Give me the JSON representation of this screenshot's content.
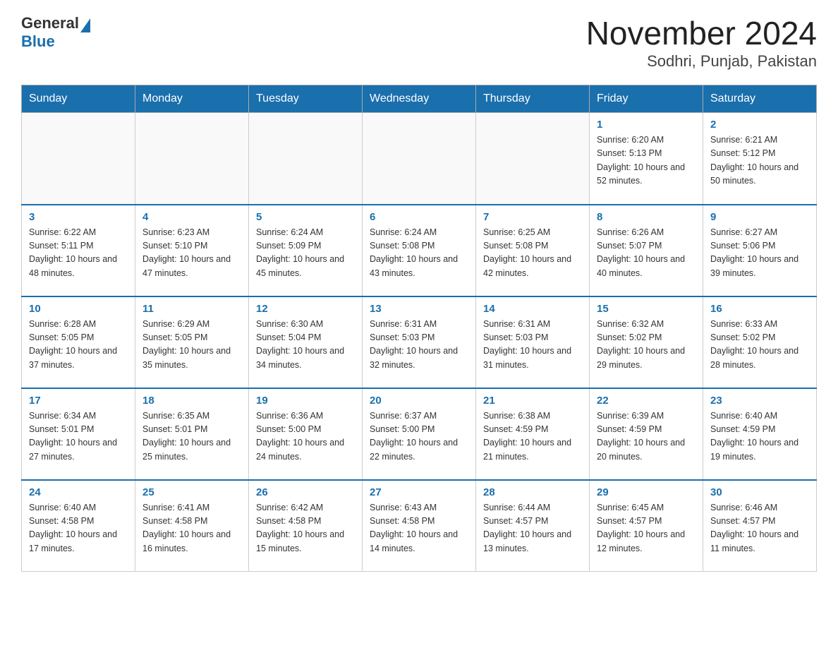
{
  "header": {
    "logo_general": "General",
    "logo_blue": "Blue",
    "title": "November 2024",
    "subtitle": "Sodhri, Punjab, Pakistan"
  },
  "days_of_week": [
    "Sunday",
    "Monday",
    "Tuesday",
    "Wednesday",
    "Thursday",
    "Friday",
    "Saturday"
  ],
  "weeks": [
    [
      {
        "day": "",
        "info": ""
      },
      {
        "day": "",
        "info": ""
      },
      {
        "day": "",
        "info": ""
      },
      {
        "day": "",
        "info": ""
      },
      {
        "day": "",
        "info": ""
      },
      {
        "day": "1",
        "info": "Sunrise: 6:20 AM\nSunset: 5:13 PM\nDaylight: 10 hours and 52 minutes."
      },
      {
        "day": "2",
        "info": "Sunrise: 6:21 AM\nSunset: 5:12 PM\nDaylight: 10 hours and 50 minutes."
      }
    ],
    [
      {
        "day": "3",
        "info": "Sunrise: 6:22 AM\nSunset: 5:11 PM\nDaylight: 10 hours and 48 minutes."
      },
      {
        "day": "4",
        "info": "Sunrise: 6:23 AM\nSunset: 5:10 PM\nDaylight: 10 hours and 47 minutes."
      },
      {
        "day": "5",
        "info": "Sunrise: 6:24 AM\nSunset: 5:09 PM\nDaylight: 10 hours and 45 minutes."
      },
      {
        "day": "6",
        "info": "Sunrise: 6:24 AM\nSunset: 5:08 PM\nDaylight: 10 hours and 43 minutes."
      },
      {
        "day": "7",
        "info": "Sunrise: 6:25 AM\nSunset: 5:08 PM\nDaylight: 10 hours and 42 minutes."
      },
      {
        "day": "8",
        "info": "Sunrise: 6:26 AM\nSunset: 5:07 PM\nDaylight: 10 hours and 40 minutes."
      },
      {
        "day": "9",
        "info": "Sunrise: 6:27 AM\nSunset: 5:06 PM\nDaylight: 10 hours and 39 minutes."
      }
    ],
    [
      {
        "day": "10",
        "info": "Sunrise: 6:28 AM\nSunset: 5:05 PM\nDaylight: 10 hours and 37 minutes."
      },
      {
        "day": "11",
        "info": "Sunrise: 6:29 AM\nSunset: 5:05 PM\nDaylight: 10 hours and 35 minutes."
      },
      {
        "day": "12",
        "info": "Sunrise: 6:30 AM\nSunset: 5:04 PM\nDaylight: 10 hours and 34 minutes."
      },
      {
        "day": "13",
        "info": "Sunrise: 6:31 AM\nSunset: 5:03 PM\nDaylight: 10 hours and 32 minutes."
      },
      {
        "day": "14",
        "info": "Sunrise: 6:31 AM\nSunset: 5:03 PM\nDaylight: 10 hours and 31 minutes."
      },
      {
        "day": "15",
        "info": "Sunrise: 6:32 AM\nSunset: 5:02 PM\nDaylight: 10 hours and 29 minutes."
      },
      {
        "day": "16",
        "info": "Sunrise: 6:33 AM\nSunset: 5:02 PM\nDaylight: 10 hours and 28 minutes."
      }
    ],
    [
      {
        "day": "17",
        "info": "Sunrise: 6:34 AM\nSunset: 5:01 PM\nDaylight: 10 hours and 27 minutes."
      },
      {
        "day": "18",
        "info": "Sunrise: 6:35 AM\nSunset: 5:01 PM\nDaylight: 10 hours and 25 minutes."
      },
      {
        "day": "19",
        "info": "Sunrise: 6:36 AM\nSunset: 5:00 PM\nDaylight: 10 hours and 24 minutes."
      },
      {
        "day": "20",
        "info": "Sunrise: 6:37 AM\nSunset: 5:00 PM\nDaylight: 10 hours and 22 minutes."
      },
      {
        "day": "21",
        "info": "Sunrise: 6:38 AM\nSunset: 4:59 PM\nDaylight: 10 hours and 21 minutes."
      },
      {
        "day": "22",
        "info": "Sunrise: 6:39 AM\nSunset: 4:59 PM\nDaylight: 10 hours and 20 minutes."
      },
      {
        "day": "23",
        "info": "Sunrise: 6:40 AM\nSunset: 4:59 PM\nDaylight: 10 hours and 19 minutes."
      }
    ],
    [
      {
        "day": "24",
        "info": "Sunrise: 6:40 AM\nSunset: 4:58 PM\nDaylight: 10 hours and 17 minutes."
      },
      {
        "day": "25",
        "info": "Sunrise: 6:41 AM\nSunset: 4:58 PM\nDaylight: 10 hours and 16 minutes."
      },
      {
        "day": "26",
        "info": "Sunrise: 6:42 AM\nSunset: 4:58 PM\nDaylight: 10 hours and 15 minutes."
      },
      {
        "day": "27",
        "info": "Sunrise: 6:43 AM\nSunset: 4:58 PM\nDaylight: 10 hours and 14 minutes."
      },
      {
        "day": "28",
        "info": "Sunrise: 6:44 AM\nSunset: 4:57 PM\nDaylight: 10 hours and 13 minutes."
      },
      {
        "day": "29",
        "info": "Sunrise: 6:45 AM\nSunset: 4:57 PM\nDaylight: 10 hours and 12 minutes."
      },
      {
        "day": "30",
        "info": "Sunrise: 6:46 AM\nSunset: 4:57 PM\nDaylight: 10 hours and 11 minutes."
      }
    ]
  ]
}
